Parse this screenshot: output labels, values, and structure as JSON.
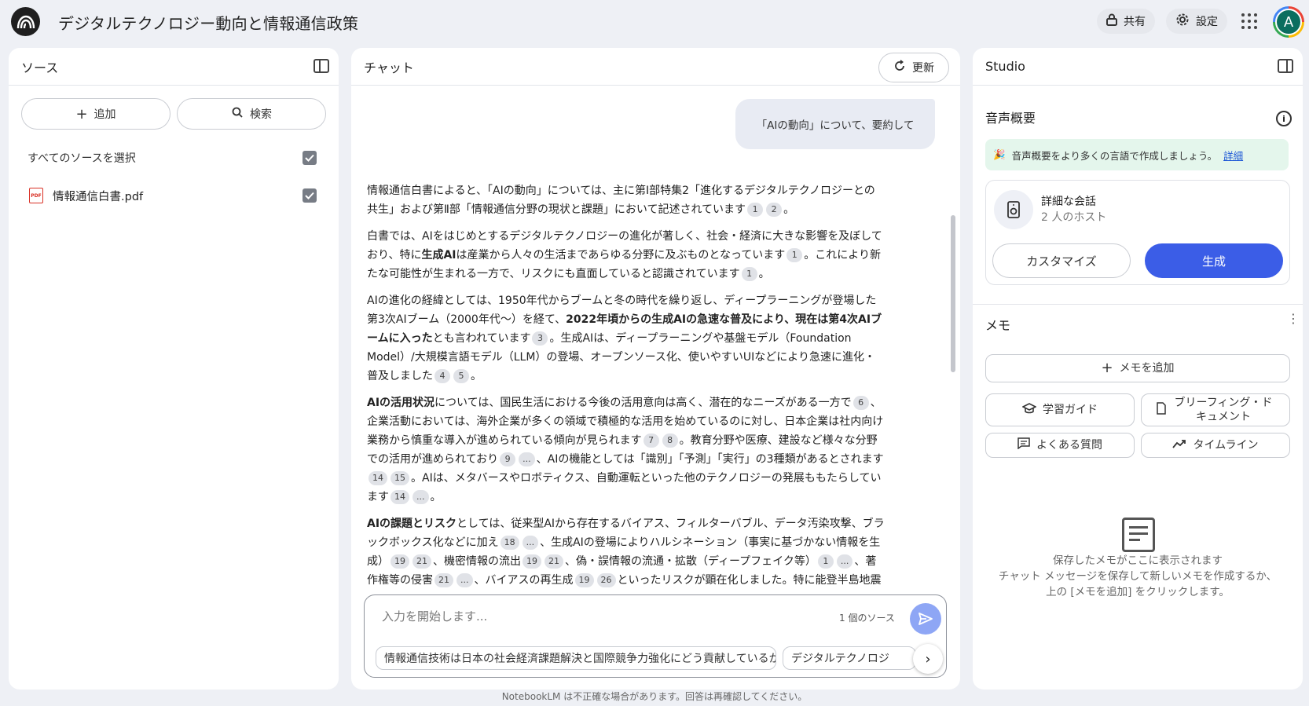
{
  "header": {
    "title": "デジタルテクノロジー動向と情報通信政策",
    "share_label": "共有",
    "settings_label": "設定",
    "avatar_initial": "A"
  },
  "sources": {
    "title": "ソース",
    "add_label": "追加",
    "search_label": "検索",
    "select_all_label": "すべてのソースを選択",
    "items": [
      {
        "name": "情報通信白書.pdf",
        "checked": true
      }
    ]
  },
  "chat": {
    "title": "チャット",
    "update_label": "更新",
    "user_message": "「AIの動向」について、要約して",
    "input_placeholder": "入力を開始します...",
    "source_count": "1 個のソース",
    "suggestions": [
      "情報通信技術は日本の社会経済課題解決と国際競争力強化にどう貢献しているか？",
      "デジタルテクノロジ"
    ],
    "answer": {
      "p1": {
        "t1": "情報通信白書によると、「AIの動向」については、主に第Ⅰ部特集2「進化するデジタルテクノロジーとの共生」および第Ⅱ部「情報通信分野の現状と課題」において記述されています",
        "c1": "1",
        "c2": "2",
        "t2": "。"
      },
      "p2": {
        "t1": "白書では、AIをはじめとするデジタルテクノロジーの進化が著しく、社会・経済に大きな影響を及ぼしており、特に",
        "b1": "生成AI",
        "t2": "は産業から人々の生活まであらゆる分野に及ぶものとなっています",
        "c1": "1",
        "t3": "。これにより新たな可能性が生まれる一方で、リスクにも直面していると認識されています",
        "c2": "1",
        "t4": "。"
      },
      "p3": {
        "t1": "AIの進化の経緯としては、1950年代からブームと冬の時代を繰り返し、ディープラーニングが登場した第3次AIブーム（2000年代〜）を経て、",
        "b1": "2022年頃からの生成AIの急速な普及により、現在は第4次AIブームに入った",
        "t2": "とも言われています",
        "c1": "3",
        "t3": "。生成AIは、ディープラーニングや基盤モデル（Foundation Model）/大規模言語モデル（LLM）の登場、オープンソース化、使いやすいUIなどにより急速に進化・普及しました",
        "c2": "4",
        "c3": "5",
        "t4": "。"
      },
      "p4": {
        "b1": "AIの活用状況",
        "t1": "については、国民生活における今後の活用意向は高く、潜在的なニーズがある一方で",
        "c1": "6",
        "t2": "、企業活動においては、海外企業が多くの領域で積極的な活用を始めているのに対し、日本企業は社内向け業務から慎重な導入が進められている傾向が見られます",
        "c2": "7",
        "c3": "8",
        "t3": "。教育分野や医療、建設など様々な分野での活用が進められており",
        "c4": "9",
        "c5": "...",
        "t4": "、AIの機能としては「識別」「予測」「実行」の3種類があるとされます",
        "c6": "14",
        "c7": "15",
        "t5": "。AIは、メタバースやロボティクス、自動運転といった他のテクノロジーの発展ももたらしています",
        "c8": "14",
        "c9": "...",
        "t6": "。"
      },
      "p5": {
        "b1": "AIの課題とリスク",
        "t1": "としては、従来型AIから存在するバイアス、フィルターバブル、データ汚染攻撃、ブラックボックス化などに加え",
        "c1": "18",
        "c2": "...",
        "t2": "、生成AIの登場によりハルシネーション（事実に基づかない情報を生成）",
        "c3": "19",
        "c4": "21",
        "t3": "、機密情報の流出",
        "c5": "19",
        "c6": "21",
        "t4": "、偽・誤情報の流通・拡散（ディープフェイク等）",
        "c7": "1",
        "c8": "...",
        "t5": "、著作権等の侵害",
        "c9": "21",
        "c10": "...",
        "t6": "、バイアスの再生成",
        "c11": "19",
        "c12": "26",
        "t7": "といったリスクが顕在化しました。特に能登半島地震"
      }
    },
    "disclaimer": "NotebookLM は不正確な場合があります。回答は再確認してください。"
  },
  "studio": {
    "title": "Studio",
    "audio_overview_title": "音声概要",
    "banner_text": "音声概要をより多くの言語で作成しましょう。",
    "banner_link": "詳細",
    "card_title": "詳細な会話",
    "card_subtitle": "2 人のホスト",
    "customize_label": "カスタマイズ",
    "generate_label": "生成",
    "memo_title": "メモ",
    "add_memo_label": "メモを追加",
    "note_buttons": {
      "study_guide": "学習ガイド",
      "briefing_doc": "ブリーフィング・ドキュメント",
      "faq": "よくある質問",
      "timeline": "タイムライン"
    },
    "empty_line1": "保存したメモがここに表示されます",
    "empty_line2": "チャット メッセージを保存して新しいメモを作成するか、",
    "empty_line3": "上の [メモを追加] をクリックします。"
  },
  "colors": {
    "accent": "#3b5de7",
    "banner_bg": "#e4f6ec",
    "pdf_red": "#d93025"
  }
}
